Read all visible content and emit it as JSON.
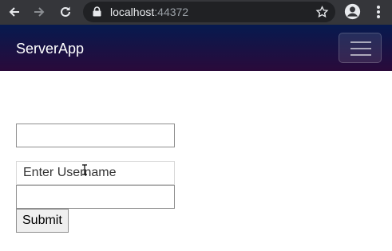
{
  "browser": {
    "url_host": "localhost",
    "url_port": ":44372",
    "icons": [
      "back-icon",
      "forward-icon",
      "reload-icon",
      "lock-icon",
      "star-icon",
      "profile-icon",
      "more-menu-icon"
    ]
  },
  "navbar": {
    "brand": "ServerApp",
    "colors": {
      "top": "#061a4f",
      "bottom": "#2a0a3a"
    }
  },
  "form": {
    "field1": {
      "value": "",
      "placeholder": ""
    },
    "username": {
      "value": "",
      "placeholder": "Enter Username"
    },
    "field3": {
      "value": "",
      "placeholder": ""
    },
    "submit_label": "Submit"
  }
}
